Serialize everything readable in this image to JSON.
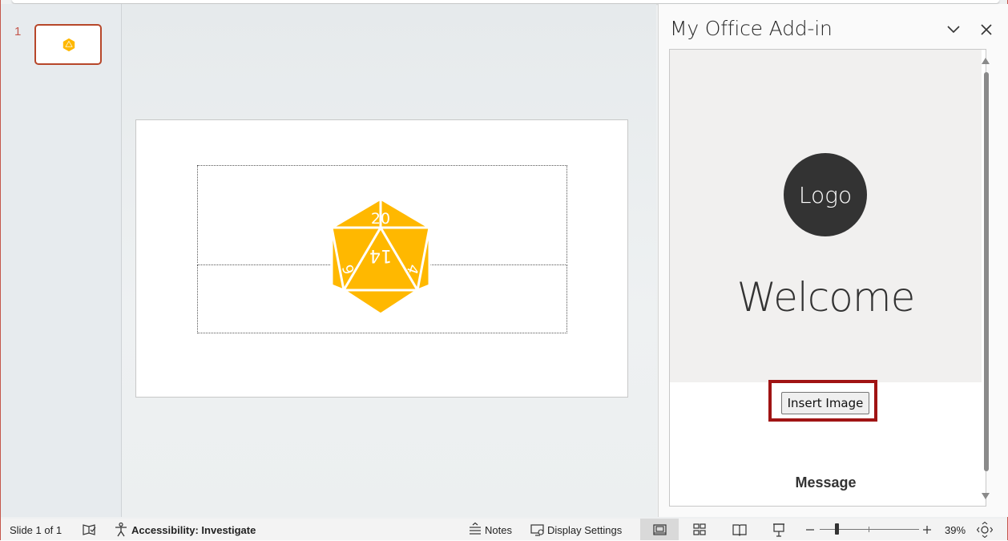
{
  "thumbnails": {
    "slide_number": "1"
  },
  "slide": {
    "d20_numbers": {
      "top": "20",
      "center": "14",
      "left": "6",
      "right": "4"
    },
    "colors": {
      "die_fill": "#FFB800",
      "die_lines": "#FFFFFF"
    }
  },
  "taskpane": {
    "title": "My Office Add-in",
    "collapse_icon": "chevron-down-icon",
    "close_icon": "close-icon",
    "addin": {
      "logo_text": "Logo",
      "welcome_text": "Welcome",
      "insert_button_label": "Insert Image",
      "message_label": "Message",
      "highlight_color": "#A01414"
    }
  },
  "statusbar": {
    "slide_indicator": "Slide 1 of 1",
    "accessibility": "Accessibility: Investigate",
    "notes_label": "Notes",
    "display_settings_label": "Display Settings",
    "zoom_level": "39%"
  }
}
